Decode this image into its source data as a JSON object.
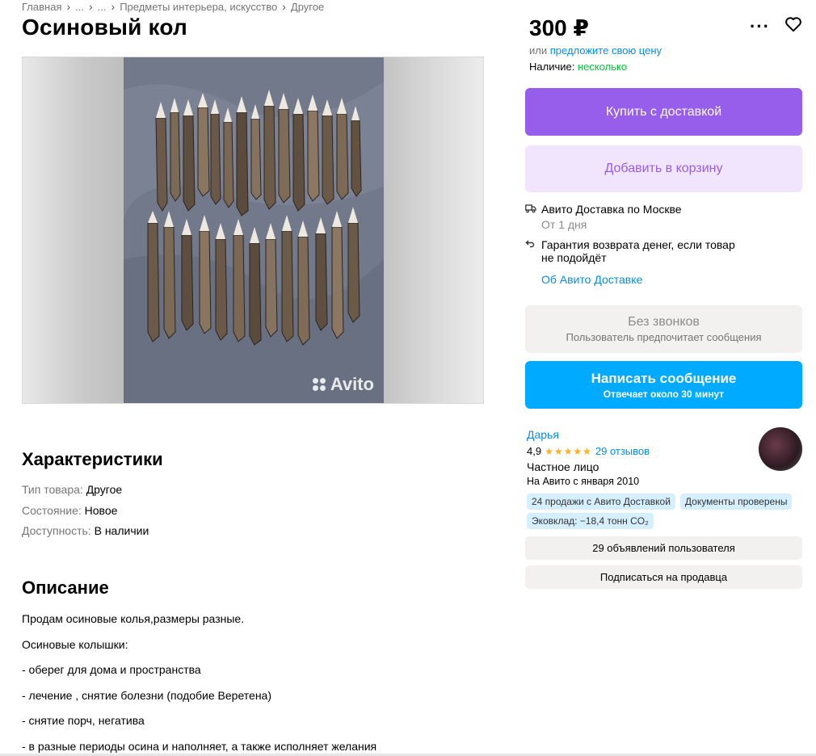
{
  "breadcrumbs": [
    "Главная",
    "...",
    "...",
    "Предметы интерьера, искусство",
    "Другое"
  ],
  "title": "Осиновый кол",
  "watermark": "Avito",
  "characteristics": {
    "heading": "Характеристики",
    "items": [
      {
        "key": "Тип товара:",
        "value": "Другое"
      },
      {
        "key": "Состояние:",
        "value": "Новое"
      },
      {
        "key": "Доступность:",
        "value": "В наличии"
      }
    ]
  },
  "description": {
    "heading": "Описание",
    "lines": [
      "Продам осиновые колья,размеры разные.",
      "Осиновые колышки:",
      "- оберег для дома и пространства",
      "- лечение , снятие болезни (подобие Веретена)",
      "- снятие порч, негатива",
      "- в разные периоды осина и наполняет, а также исполняет желания"
    ]
  },
  "price": {
    "value": "300 ₽",
    "offer_prefix": "или",
    "offer_link": "предложите свою цену",
    "availability_label": "Наличие:",
    "availability_value": "несколько"
  },
  "buttons": {
    "buy": "Купить с доставкой",
    "cart": "Добавить в корзину",
    "no_calls_title": "Без звонков",
    "no_calls_sub": "Пользователь предпочитает сообщения",
    "message_title": "Написать сообщение",
    "message_sub": "Отвечает около 30 минут"
  },
  "delivery": {
    "title": "Авито Доставка по Москве",
    "sub": "От 1 дня",
    "guarantee_line1": "Гарантия возврата денег, если товар",
    "guarantee_line2": "не подойдёт",
    "link": "Об Авито Доставке"
  },
  "seller": {
    "name": "Дарья",
    "rating": "4,9",
    "stars": "★★★★★",
    "reviews": "29 отзывов",
    "type": "Частное лицо",
    "since": "На Авито с января 2010",
    "badges": [
      "24 продажи с Авито Доставкой",
      "Документы проверены",
      "Эковклад: −18,4 тонн CO₂"
    ],
    "listings_button": "29 объявлений пользователя",
    "subscribe_button": "Подписаться на продавца"
  },
  "colors": {
    "accent_purple": "#965eeb",
    "accent_blue": "#00aaff",
    "link_blue": "#0a8de6",
    "green": "#02c63a"
  }
}
